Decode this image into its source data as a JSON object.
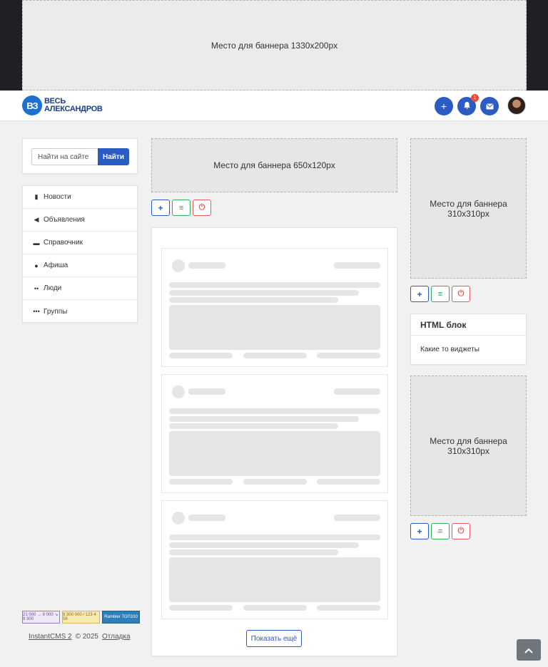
{
  "banners": {
    "top": "Место для баннера 1330x200px",
    "center": "Место для баннера 650x120px",
    "right1": "Место для баннера 310x310px",
    "right2": "Место для баннера 310x310px"
  },
  "header": {
    "logo_mark": "ВЗ",
    "logo_line1": "ВЕСЬ",
    "logo_line2": "АЛЕКСАНДРОВ",
    "notification_count": "1",
    "add_icon": "plus-icon",
    "notify_icon": "bell-icon",
    "mail_icon": "envelope-icon"
  },
  "search": {
    "placeholder": "Найти на сайте",
    "button": "Найти"
  },
  "menu": [
    {
      "label": "Новости",
      "icon": "file-icon"
    },
    {
      "label": "Объявления",
      "icon": "megaphone-icon"
    },
    {
      "label": "Справочник",
      "icon": "book-icon"
    },
    {
      "label": "Афиша",
      "icon": "user-icon"
    },
    {
      "label": "Люди",
      "icon": "users-icon"
    },
    {
      "label": "Группы",
      "icon": "group-icon"
    }
  ],
  "widget": {
    "title": "HTML блок",
    "body": "Какие то виджеты"
  },
  "feed": {
    "more_button": "Показать ещё"
  },
  "counters": [
    "21 000 → 9 000 ↘ 9 300",
    "8 300 000 / 123 4 56",
    "Rambler ТОП100"
  ],
  "footer": {
    "cms": "InstantCMS 2",
    "copyright": "© 2025",
    "debug": "Отладка"
  },
  "colors": {
    "primary": "#2b5cc3",
    "success": "#3aaa5c",
    "danger": "#e55b5b",
    "dark": "#1e2023"
  }
}
